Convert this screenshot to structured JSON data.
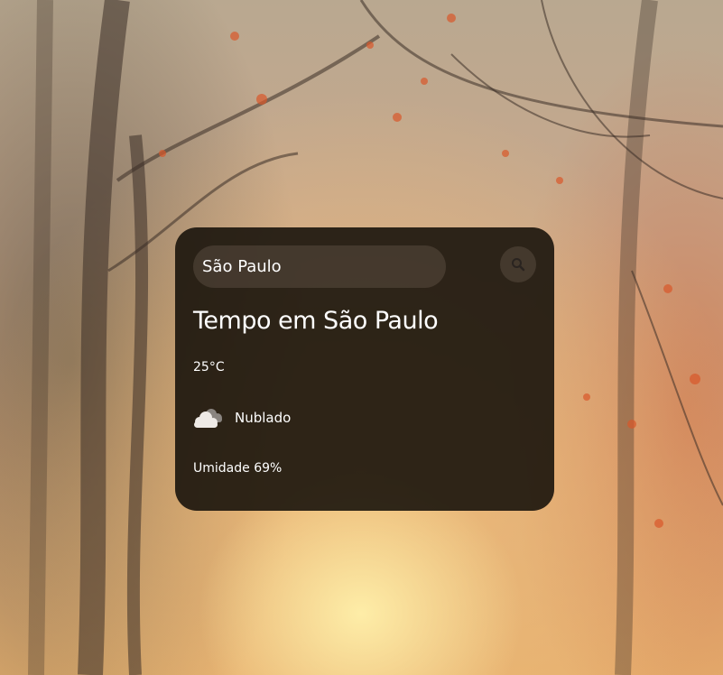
{
  "search": {
    "value": "São Paulo",
    "button_icon": "search-icon"
  },
  "weather": {
    "title": "Tempo em São Paulo",
    "temperature": "25°C",
    "icon": "cloud-icon",
    "description": "Nublado",
    "humidity": "Umidade 69%"
  }
}
